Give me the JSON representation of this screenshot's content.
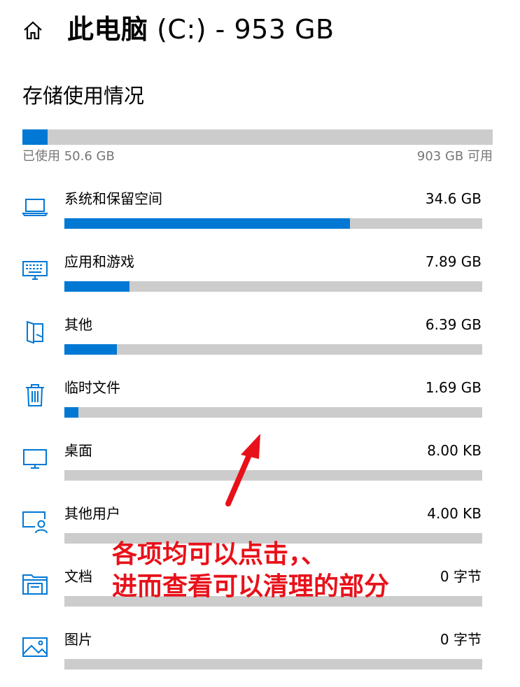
{
  "header": {
    "title_main": "此电脑",
    "title_sub": "(C:) - 953 GB"
  },
  "storage": {
    "section_title": "存储使用情况",
    "used_label": "已使用 50.6 GB",
    "free_label": "903 GB 可用",
    "used_fraction": 0.053
  },
  "categories": [
    {
      "name": "系统和保留空间",
      "size": "34.6 GB",
      "fraction": 0.684,
      "icon": "laptop-icon"
    },
    {
      "name": "应用和游戏",
      "size": "7.89 GB",
      "fraction": 0.156,
      "icon": "keyboard-icon"
    },
    {
      "name": "其他",
      "size": "6.39 GB",
      "fraction": 0.126,
      "icon": "folded-document-icon"
    },
    {
      "name": "临时文件",
      "size": "1.69 GB",
      "fraction": 0.033,
      "icon": "trash-icon"
    },
    {
      "name": "桌面",
      "size": "8.00 KB",
      "fraction": 0,
      "icon": "monitor-icon"
    },
    {
      "name": "其他用户",
      "size": "4.00 KB",
      "fraction": 0,
      "icon": "user-screen-icon"
    },
    {
      "name": "文档",
      "size": "0 字节",
      "fraction": 0,
      "icon": "folder-documents-icon"
    },
    {
      "name": "图片",
      "size": "0 字节",
      "fraction": 0,
      "icon": "picture-icon"
    }
  ],
  "annotation": {
    "line1": "各项均可以点击，、",
    "line2": "进而查看可以清理的部分",
    "color": "#e8111a"
  },
  "colors": {
    "accent": "#0078d4",
    "bar_track": "#cccccc"
  }
}
